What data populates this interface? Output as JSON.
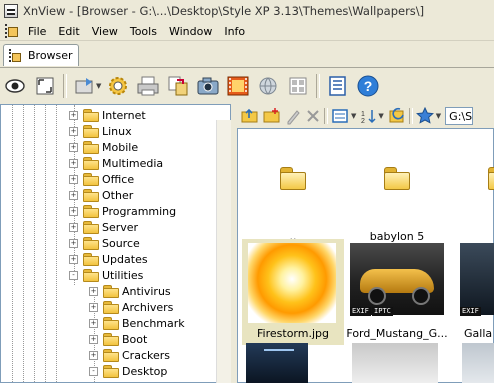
{
  "window": {
    "title": "XnView - [Browser - G:\\...\\Desktop\\Style XP 3.13\\Themes\\Wallpapers\\]"
  },
  "menu": {
    "items": [
      "File",
      "Edit",
      "View",
      "Tools",
      "Window",
      "Info"
    ]
  },
  "tabs": [
    {
      "label": "Browser"
    }
  ],
  "toolbar": {
    "buttons": [
      "view-icon",
      "fullscreen-icon",
      "acquire-icon",
      "find-icon",
      "print-icon",
      "convert-icon",
      "capture-icon",
      "slideshow-icon",
      "web-icon",
      "layout-icon",
      "properties-icon",
      "help-icon"
    ]
  },
  "tree": {
    "items": [
      {
        "label": "Internet",
        "level": 0,
        "expander": "+"
      },
      {
        "label": "Linux",
        "level": 0,
        "expander": "+"
      },
      {
        "label": "Mobile",
        "level": 0,
        "expander": "+"
      },
      {
        "label": "Multimedia",
        "level": 0,
        "expander": "+"
      },
      {
        "label": "Office",
        "level": 0,
        "expander": "+"
      },
      {
        "label": "Other",
        "level": 0,
        "expander": "+"
      },
      {
        "label": "Programming",
        "level": 0,
        "expander": "+"
      },
      {
        "label": "Server",
        "level": 0,
        "expander": "+"
      },
      {
        "label": "Source",
        "level": 0,
        "expander": "+"
      },
      {
        "label": "Updates",
        "level": 0,
        "expander": "+"
      },
      {
        "label": "Utilities",
        "level": 0,
        "expander": "-"
      },
      {
        "label": "Antivirus",
        "level": 1,
        "expander": "+"
      },
      {
        "label": "Archivers",
        "level": 1,
        "expander": "+"
      },
      {
        "label": "Benchmark",
        "level": 1,
        "expander": "+"
      },
      {
        "label": "Boot",
        "level": 1,
        "expander": "+"
      },
      {
        "label": "Crackers",
        "level": 1,
        "expander": "+"
      },
      {
        "label": "Desktop",
        "level": 1,
        "expander": "-"
      }
    ]
  },
  "address": {
    "value": "G:\\S"
  },
  "thumbnails": [
    {
      "caption": "..",
      "kind": "folder"
    },
    {
      "caption": "babylon 5",
      "kind": "folder"
    },
    {
      "caption": "Firestorm.jpg",
      "kind": "image",
      "selected": true
    },
    {
      "caption": "Ford_Mustang_G...",
      "kind": "image",
      "badges": [
        "EXIF",
        "IPTC"
      ]
    },
    {
      "caption": "Galla",
      "kind": "image",
      "badges": [
        "EXIF"
      ]
    }
  ],
  "colors": {
    "chrome": "#ece9d8",
    "selection": "#e8e4c0",
    "folder": "#f3c846"
  }
}
